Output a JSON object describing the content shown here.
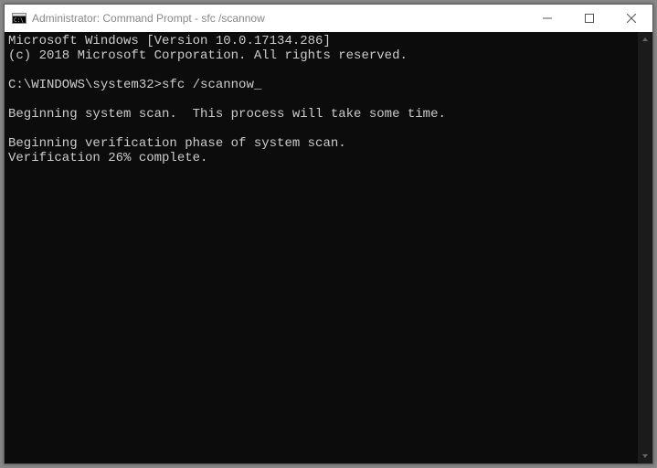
{
  "window": {
    "title": "Administrator: Command Prompt - sfc  /scannow"
  },
  "console": {
    "header_line1": "Microsoft Windows [Version 10.0.17134.286]",
    "header_line2": "(c) 2018 Microsoft Corporation. All rights reserved.",
    "prompt_path": "C:\\WINDOWS\\system32>",
    "command": "sfc /scannow",
    "msg_scan_start": "Beginning system scan.  This process will take some time.",
    "msg_verify_phase": "Beginning verification phase of system scan.",
    "msg_verify_progress": "Verification 26% complete."
  }
}
